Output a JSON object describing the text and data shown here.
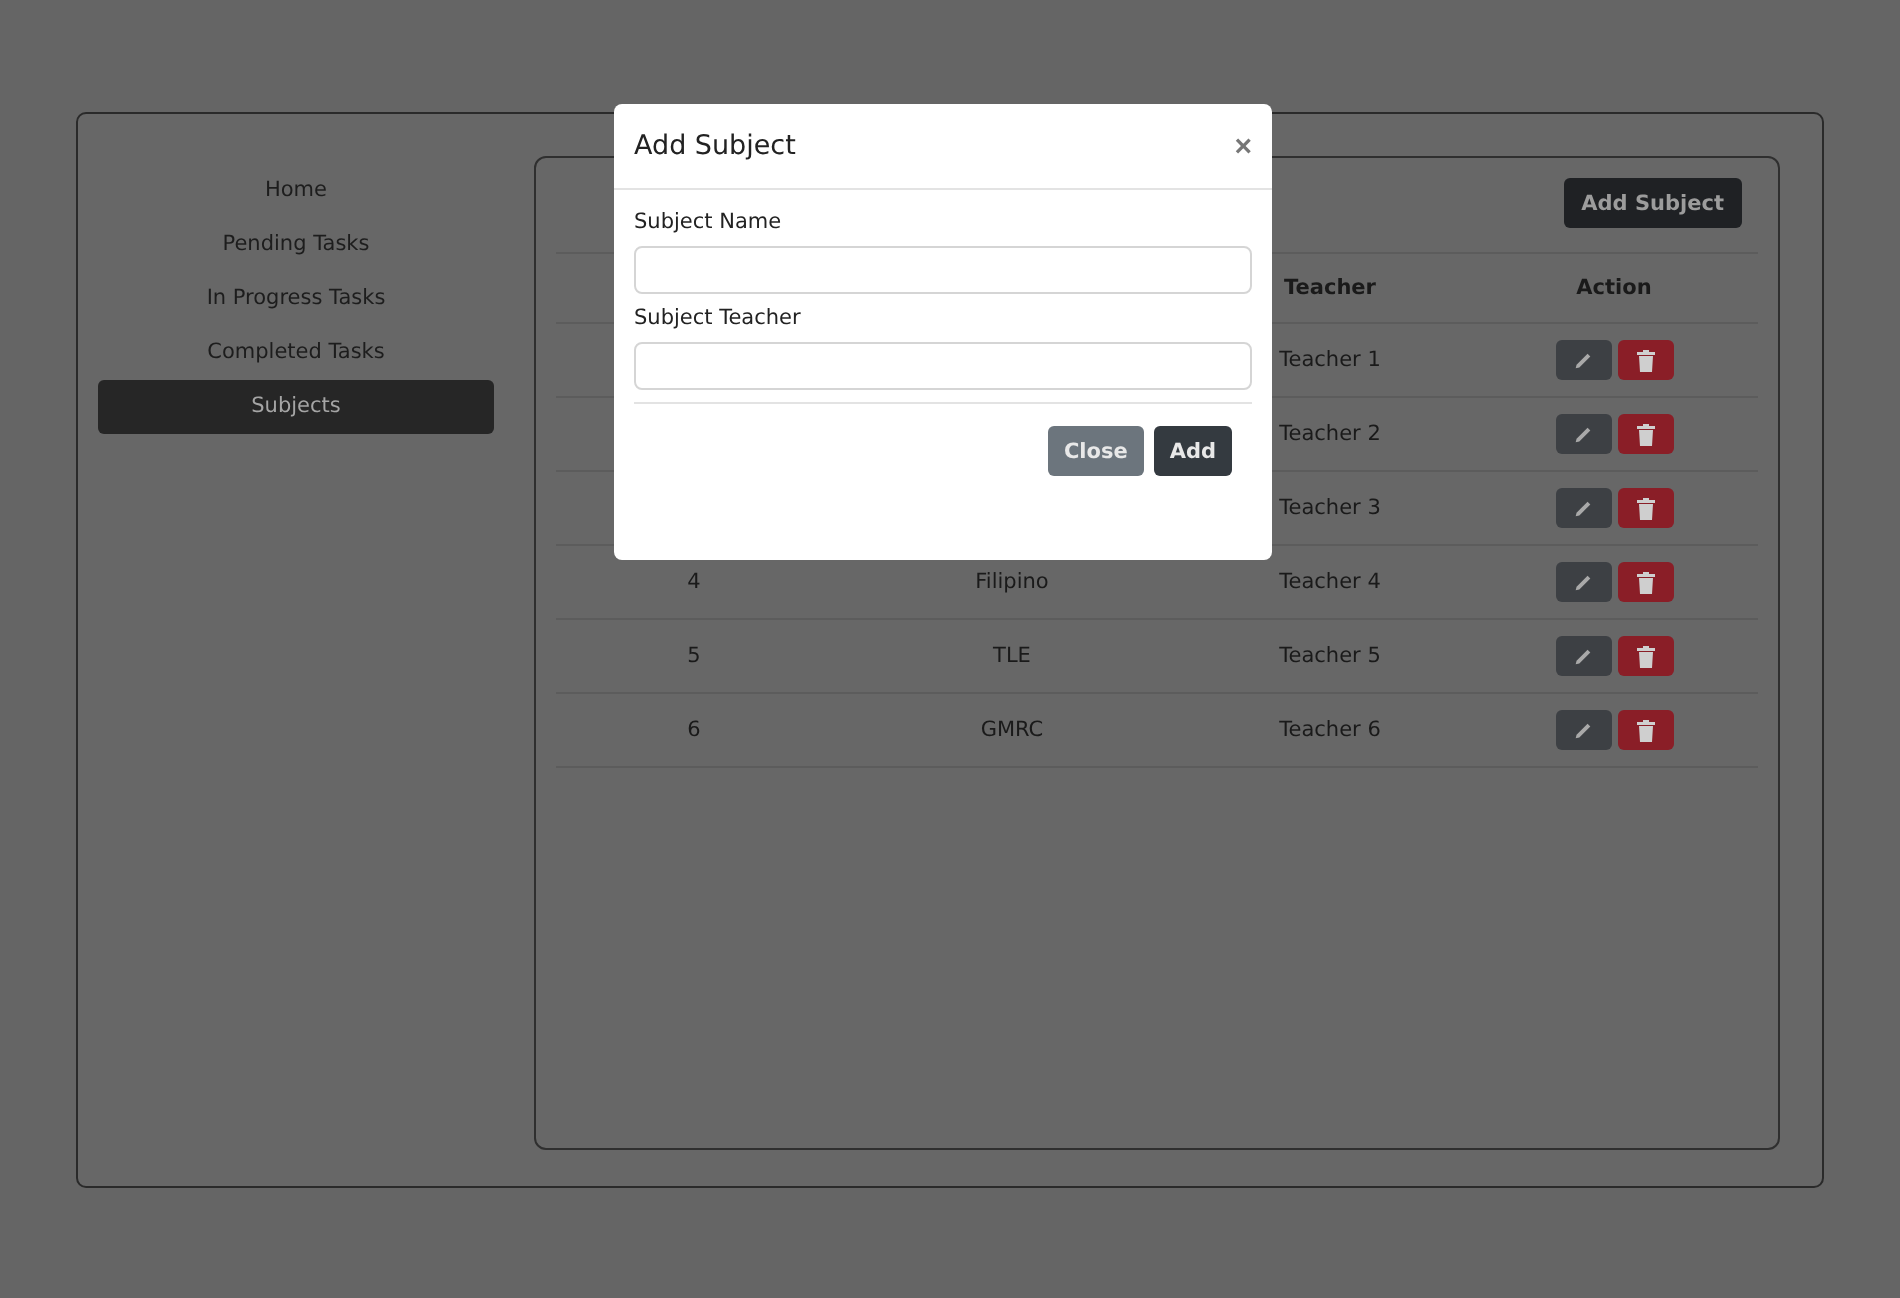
{
  "sidebar": {
    "items": [
      {
        "label": "Home",
        "selected": false
      },
      {
        "label": "Pending Tasks",
        "selected": false
      },
      {
        "label": "In Progress Tasks",
        "selected": false
      },
      {
        "label": "Completed Tasks",
        "selected": false
      },
      {
        "label": "Subjects",
        "selected": true
      }
    ]
  },
  "panel": {
    "add_button": "Add Subject",
    "table": {
      "columns": [
        "Teacher",
        "Action"
      ],
      "rows": [
        {
          "teacher": "Teacher 1"
        },
        {
          "teacher": "Teacher 2"
        },
        {
          "teacher": "Teacher 3"
        },
        {
          "number": "4",
          "subject": "Filipino",
          "teacher": "Teacher 4"
        },
        {
          "number": "5",
          "subject": "TLE",
          "teacher": "Teacher 5"
        },
        {
          "number": "6",
          "subject": "GMRC",
          "teacher": "Teacher 6"
        }
      ]
    }
  },
  "modal": {
    "title": "Add Subject",
    "close": "×",
    "fields": [
      {
        "label": "Subject Name"
      },
      {
        "label": "Subject Teacher"
      }
    ],
    "buttons": [
      {
        "label": "Close",
        "kind": "secondary"
      },
      {
        "label": "Add",
        "kind": "primary"
      }
    ]
  }
}
